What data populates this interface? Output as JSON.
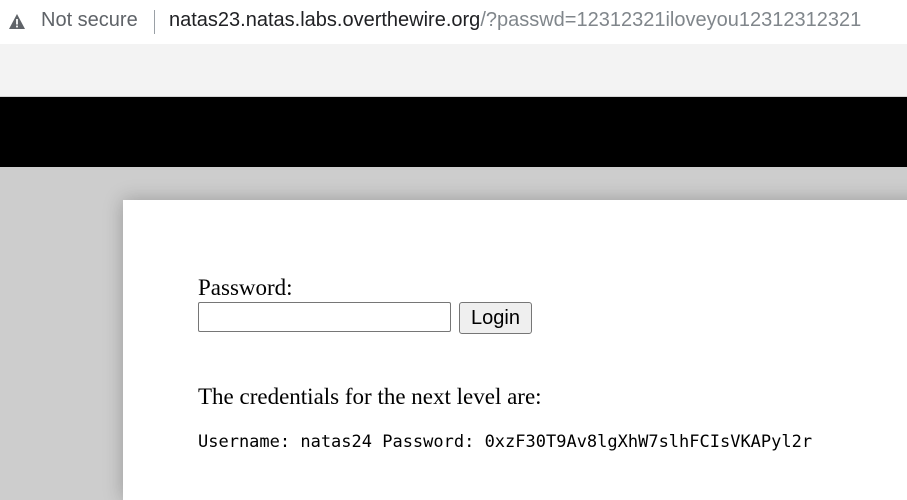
{
  "browser": {
    "security_label": "Not secure",
    "url_host": "natas23.natas.labs.overthewire.org",
    "url_path": "/?passwd=12312321iloveyou12312312321"
  },
  "form": {
    "password_label": "Password:",
    "password_value": "",
    "login_label": "Login"
  },
  "result": {
    "message": "The credentials for the next level are:",
    "credentials": "Username: natas24 Password: 0xzF30T9Av8lgXhW7slhFCIsVKAPyl2r"
  },
  "colors": {
    "header": "#000000",
    "page_background": "#cdcdcd",
    "panel": "#ffffff"
  },
  "icons": {
    "security": "warning-triangle-icon"
  }
}
